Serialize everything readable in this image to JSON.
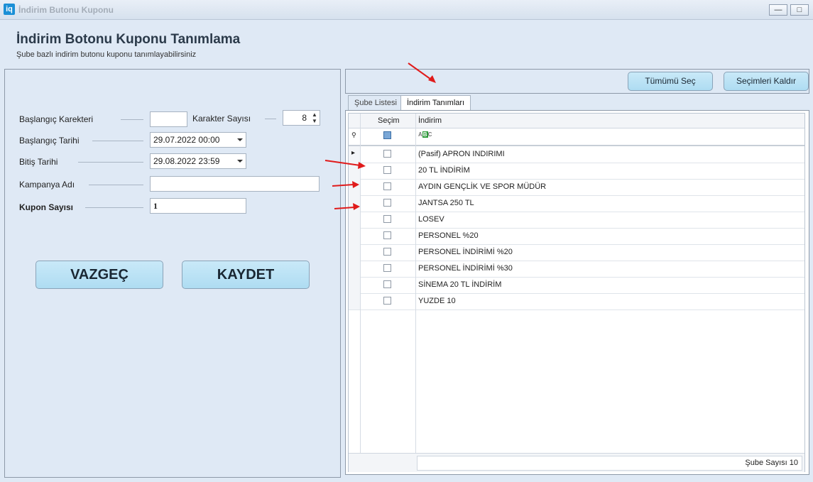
{
  "window": {
    "app_icon": "iq",
    "title": "İndirim Butonu Kuponu",
    "minimize": "—",
    "maximize": "□"
  },
  "header": {
    "title": "İndirim Botonu Kuponu Tanımlama",
    "subtitle": "Şube bazlı indirim butonu kuponu tanımlayabilirsiniz"
  },
  "form": {
    "start_char_label": "Başlangıç Karekteri",
    "start_char_value": "",
    "char_count_label": "Karakter Sayısı",
    "char_count_value": "8",
    "start_date_label": "Başlangıç Tarihi",
    "start_date_value": "29.07.2022 00:00",
    "end_date_label": "Bitiş Tarihi",
    "end_date_value": "29.08.2022 23:59",
    "campaign_label": "Kampanya Adı",
    "campaign_value": "",
    "coupon_count_label": "Kupon Sayısı",
    "coupon_count_value": "1",
    "cancel_label": "VAZGEÇ",
    "save_label": "KAYDET"
  },
  "toolbar": {
    "select_all": "Tümümü Seç",
    "clear_selection": "Seçimleri Kaldır"
  },
  "tabs": [
    {
      "label": "Şube Listesi",
      "active": false
    },
    {
      "label": "İndirim Tanımları",
      "active": true
    }
  ],
  "grid": {
    "columns": [
      "Seçim",
      "İndirim"
    ],
    "filter_icon": "abc-text-filter-icon",
    "rows": [
      {
        "label": "(Pasif) APRON INDIRIMI",
        "checked": false,
        "current": true
      },
      {
        "label": "20 TL İNDİRİM",
        "checked": false
      },
      {
        "label": "AYDIN GENÇLİK VE SPOR MÜDÜR",
        "checked": false
      },
      {
        "label": "JANTSA 250 TL",
        "checked": false
      },
      {
        "label": "LOSEV",
        "checked": false
      },
      {
        "label": "PERSONEL %20",
        "checked": false
      },
      {
        "label": "PERSONEL İNDİRİMİ %20",
        "checked": false
      },
      {
        "label": "PERSONEL İNDİRİMİ %30",
        "checked": false
      },
      {
        "label": "SİNEMA 20 TL İNDİRİM",
        "checked": false
      },
      {
        "label": "YUZDE 10",
        "checked": false
      }
    ],
    "footer_text": "Şube Sayısı 10"
  },
  "colors": {
    "accent": "#aedcf2",
    "annotation_arrow": "#e01b1b"
  }
}
